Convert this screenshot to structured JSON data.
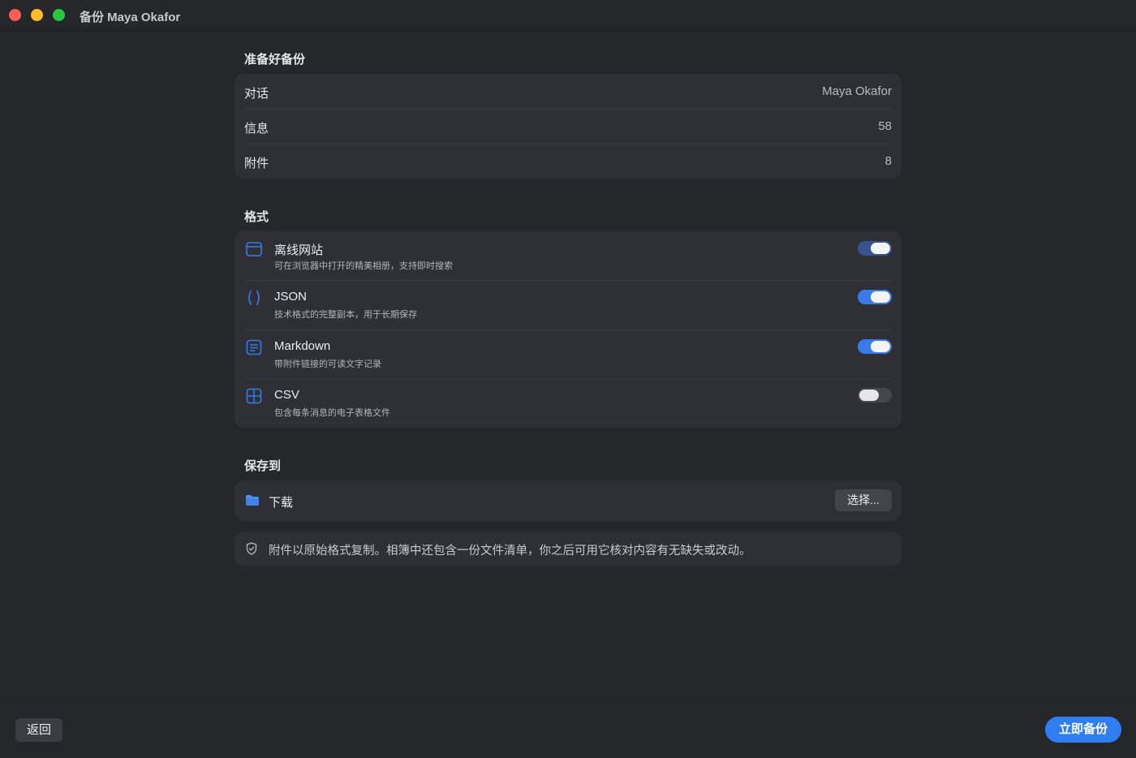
{
  "window": {
    "title": "备份 Maya Okafor"
  },
  "summary": {
    "title": "准备好备份",
    "rows": [
      {
        "label": "对话",
        "value": "Maya Okafor"
      },
      {
        "label": "信息",
        "value": "58"
      },
      {
        "label": "附件",
        "value": "8"
      }
    ]
  },
  "formats": {
    "title": "格式",
    "items": [
      {
        "name": "离线网站",
        "desc": "可在浏览器中打开的精美相册，支持即时搜索",
        "icon": "browser-window-icon",
        "enabled": true
      },
      {
        "name": "JSON",
        "desc": "技术格式的完整副本，用于长期保存",
        "icon": "braces-icon",
        "enabled": true
      },
      {
        "name": "Markdown",
        "desc": "带附件链接的可读文字记录",
        "icon": "document-text-icon",
        "enabled": true
      },
      {
        "name": "CSV",
        "desc": "包含每条消息的电子表格文件",
        "icon": "table-grid-icon",
        "enabled": false
      }
    ]
  },
  "destination": {
    "title": "保存到",
    "folder": "下载",
    "choose_label": "选择..."
  },
  "note": "附件以原始格式复制。相簿中还包含一份文件清单，你之后可用它核对内容有无缺失或改动。",
  "footer": {
    "back_label": "返回",
    "primary_label": "立即备份"
  },
  "colors": {
    "accent": "#2f7ef2",
    "background": "#25272b",
    "card": "#2e3035"
  }
}
